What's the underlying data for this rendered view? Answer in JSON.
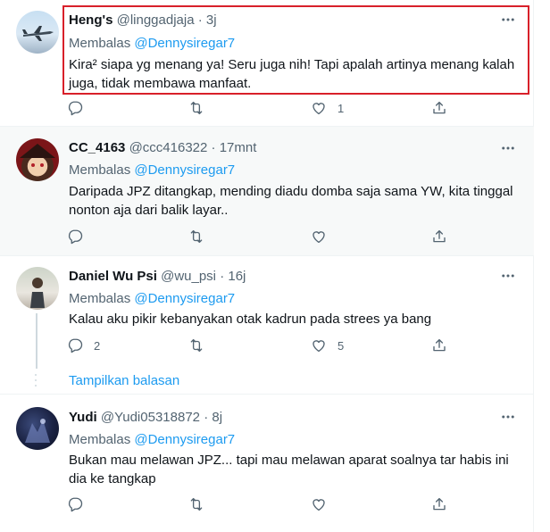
{
  "colors": {
    "accent": "#1d9bf0",
    "muted": "#536471",
    "highlight_border": "#d8202a"
  },
  "tweets": [
    {
      "name": "Heng's",
      "handle": "@linggadjaja",
      "sep": "·",
      "time": "3j",
      "reply_prefix": "Membalas",
      "reply_to": "@Dennysiregar7",
      "text": "Kira² siapa yg menang ya! Seru juga nih! Tapi apalah artinya menang kalah juga, tidak membawa manfaat.",
      "counts": {
        "reply": "",
        "retweet": "",
        "like": "1"
      }
    },
    {
      "name": "CC_4163",
      "handle": "@ccc416322",
      "sep": "·",
      "time": "17mnt",
      "reply_prefix": "Membalas",
      "reply_to": "@Dennysiregar7",
      "text": "Daripada JPZ ditangkap, mending diadu domba saja sama YW, kita tinggal nonton aja dari balik layar..",
      "counts": {
        "reply": "",
        "retweet": "",
        "like": ""
      }
    },
    {
      "name": "Daniel Wu Psi",
      "handle": "@wu_psi",
      "sep": "·",
      "time": "16j",
      "reply_prefix": "Membalas",
      "reply_to": "@Dennysiregar7",
      "text": "Kalau aku pikir kebanyakan otak kadrun pada strees ya bang",
      "counts": {
        "reply": "2",
        "retweet": "",
        "like": "5"
      },
      "show_replies": "Tampilkan balasan"
    },
    {
      "name": "Yudi",
      "handle": "@Yudi05318872",
      "sep": "·",
      "time": "8j",
      "reply_prefix": "Membalas",
      "reply_to": "@Dennysiregar7",
      "text": "Bukan mau melawan JPZ... tapi mau melawan aparat soalnya tar habis ini dia ke tangkap",
      "counts": {
        "reply": "",
        "retweet": "",
        "like": ""
      }
    }
  ],
  "icons": {
    "more": "more-horizontal-icon",
    "reply": "reply-icon",
    "retweet": "retweet-icon",
    "like": "heart-icon",
    "share": "share-icon"
  }
}
